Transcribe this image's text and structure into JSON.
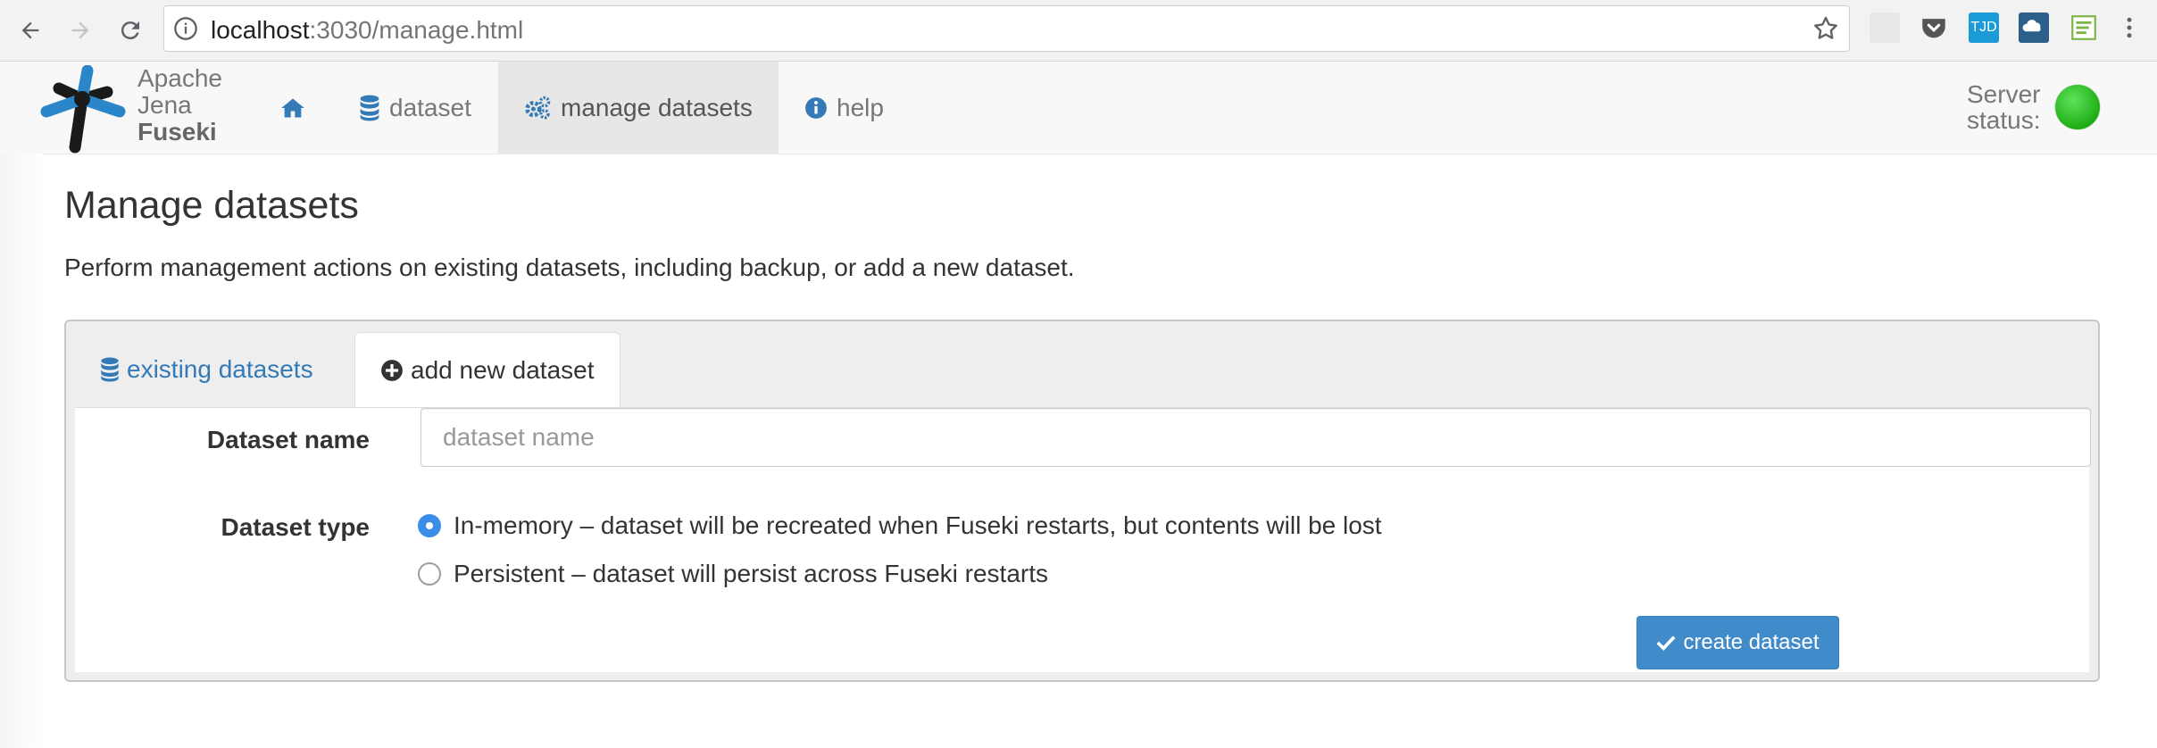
{
  "browser": {
    "url_host": "localhost",
    "url_path": ":3030/manage.html",
    "extensions": [
      "tjd-extension",
      "il-extension"
    ]
  },
  "brand": {
    "line1": "Apache",
    "line2": "Jena",
    "line3": "Fuseki"
  },
  "nav": {
    "items": [
      {
        "label": "dataset"
      },
      {
        "label": "manage datasets"
      },
      {
        "label": "help"
      }
    ],
    "server_status_line1": "Server",
    "server_status_line2": "status:",
    "server_status_color": "#22b11a"
  },
  "page": {
    "title": "Manage datasets",
    "lead": "Perform management actions on existing datasets, including backup, or add a new dataset."
  },
  "tabs": [
    {
      "label": "existing datasets",
      "active": false
    },
    {
      "label": "add new dataset",
      "active": true
    }
  ],
  "form": {
    "name_label": "Dataset name",
    "name_placeholder": "dataset name",
    "name_value": "",
    "type_label": "Dataset type",
    "options": [
      {
        "label": "In-memory – dataset will be recreated when Fuseki restarts, but contents will be lost",
        "checked": true
      },
      {
        "label": "Persistent – dataset will persist across Fuseki restarts",
        "checked": false
      }
    ],
    "submit_label": "create dataset"
  },
  "colors": {
    "accent": "#428bca",
    "link": "#337ab7"
  }
}
